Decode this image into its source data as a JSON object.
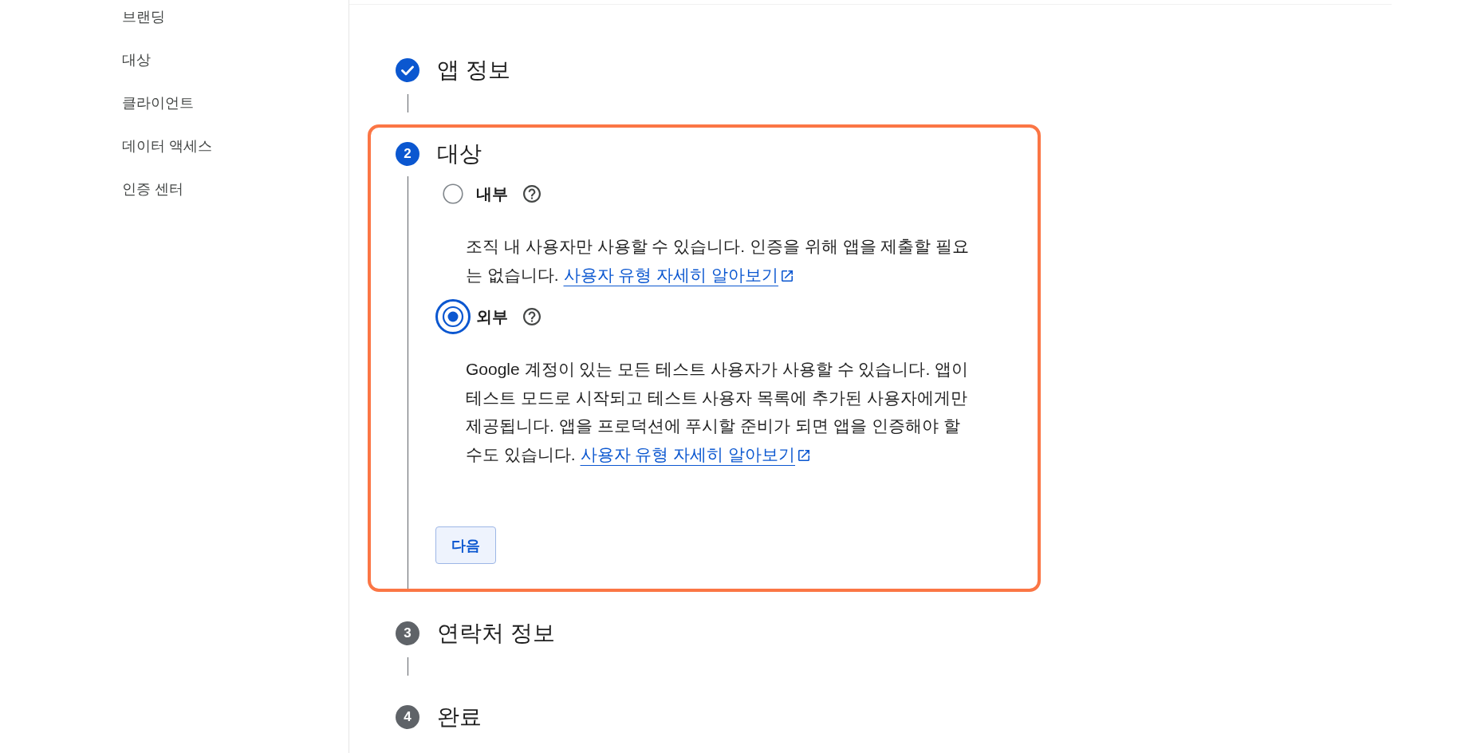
{
  "sidebar": {
    "items": [
      {
        "label": "브랜딩"
      },
      {
        "label": "대상"
      },
      {
        "label": "클라이언트"
      },
      {
        "label": "데이터 액세스"
      },
      {
        "label": "인증 센터"
      }
    ]
  },
  "steps": [
    {
      "kind": "done",
      "title": "앱 정보"
    },
    {
      "kind": "current",
      "number": "2",
      "title": "대상",
      "highlighted": true,
      "options": [
        {
          "label": "내부",
          "selected": false,
          "focused": false,
          "description": "조직 내 사용자만 사용할 수 있습니다. 인증을 위해 앱을 제출할 필요는 없습니다.",
          "link": "사용자 유형 자세히 알아보기"
        },
        {
          "label": "외부",
          "selected": true,
          "focused": true,
          "description": "Google 계정이 있는 모든 테스트 사용자가 사용할 수 있습니다. 앱이 테스트 모드로 시작되고 테스트 사용자 목록에 추가된 사용자에게만 제공됩니다. 앱을 프로덕션에 푸시할 준비가 되면 앱을 인증해야 할 수도 있습니다.",
          "link": "사용자 유형 자세히 알아보기"
        }
      ],
      "button": {
        "label": "다음"
      }
    },
    {
      "kind": "pending",
      "number": "3",
      "title": "연락처 정보"
    },
    {
      "kind": "pending",
      "number": "4",
      "title": "완료"
    }
  ]
}
